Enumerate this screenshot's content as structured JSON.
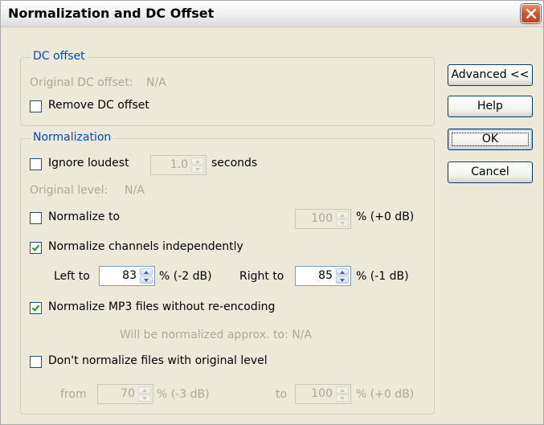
{
  "window": {
    "title": "Normalization and DC Offset"
  },
  "dc_offset": {
    "legend": "DC offset",
    "original_label": "Original DC offset:",
    "original_value": "N/A",
    "remove_label": "Remove DC offset",
    "remove_checked": false
  },
  "normalization": {
    "legend": "Normalization",
    "ignore_loudest": {
      "label": "Ignore loudest",
      "checked": false,
      "value": "1.0",
      "unit": "seconds"
    },
    "original_level_label": "Original level:",
    "original_level_value": "N/A",
    "normalize_to": {
      "label": "Normalize to",
      "checked": false,
      "value": "100",
      "unit": "% (+0 dB)"
    },
    "independent": {
      "label": "Normalize channels independently",
      "checked": true
    },
    "left": {
      "label": "Left to",
      "value": "83",
      "unit": "% (-2 dB)"
    },
    "right": {
      "label": "Right to",
      "value": "85",
      "unit": "% (-1 dB)"
    },
    "mp3": {
      "label": "Normalize MP3 files without re-encoding",
      "checked": true,
      "note": "Will be normalized approx. to: N/A"
    },
    "dont_normalize": {
      "label": "Don't normalize files with original level",
      "checked": false
    },
    "from": {
      "label": "from",
      "value": "70",
      "unit": "% (-3 dB)"
    },
    "to": {
      "label": "to",
      "value": "100",
      "unit": "% (+0 dB)"
    }
  },
  "buttons": {
    "advanced": "Advanced <<",
    "help": "Help",
    "ok": "OK",
    "cancel": "Cancel"
  }
}
